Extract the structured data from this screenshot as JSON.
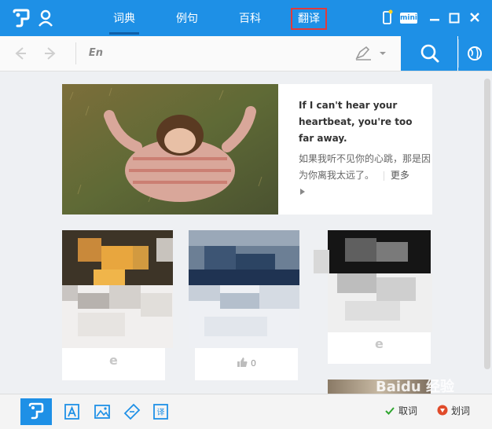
{
  "app": {
    "logo": "有道",
    "tabs": [
      {
        "label": "词典",
        "active": true
      },
      {
        "label": "例句",
        "active": false
      },
      {
        "label": "百科",
        "active": false
      },
      {
        "label": "翻译",
        "active": false
      }
    ],
    "mini_label": "mini"
  },
  "toolbar": {
    "lang": "En",
    "search_value": "",
    "search_placeholder": ""
  },
  "feature": {
    "quote_en": "If I can't hear your heartbeat, you're too far away.",
    "quote_cn": "如果我听不见你的心跳，那是因为你离我太远了。",
    "more": "更多"
  },
  "cards": [
    {
      "like_count": "",
      "logo": "e"
    },
    {
      "like_count": "0",
      "logo": ""
    },
    {
      "like_count": "",
      "logo": "e"
    }
  ],
  "bottombar": {
    "quci": "取词",
    "huaci": "划词"
  },
  "watermark": "Baidu 经验",
  "colors": {
    "brand": "#1e90e6",
    "highlight": "#e23a3a"
  }
}
